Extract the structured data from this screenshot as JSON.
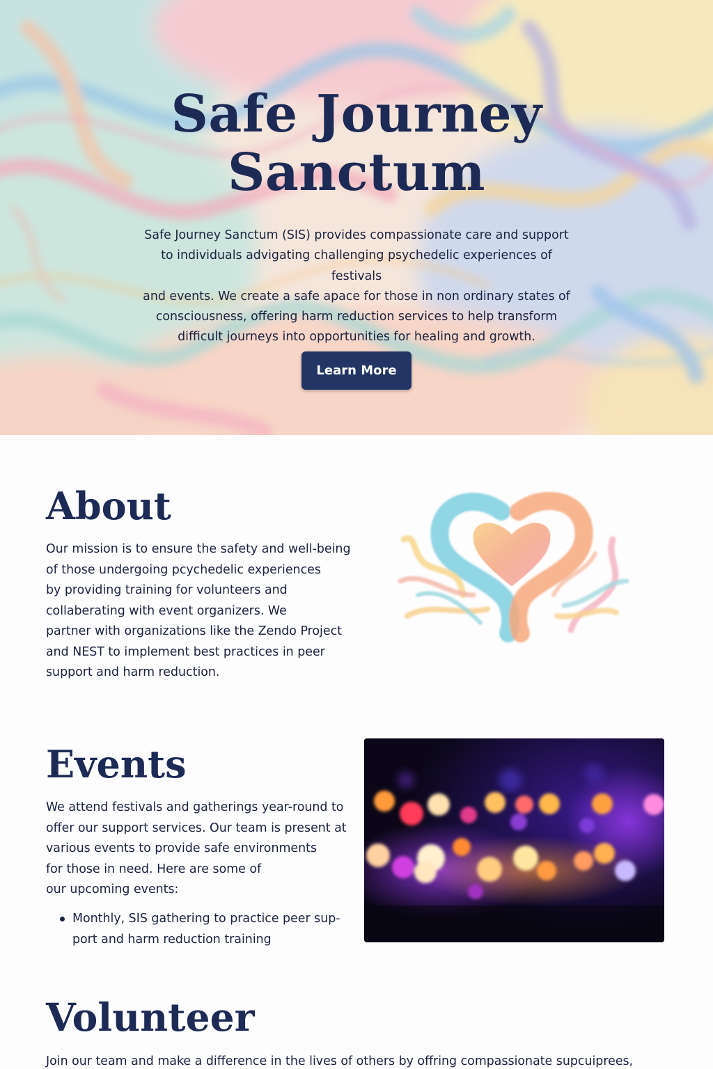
{
  "hero": {
    "title_line1": "Safe Journey",
    "title_line2": "Sanctum",
    "description": [
      "Safe Journey Sanctum (SIS) provides compassionate care and support",
      "to individuals advigating challenging psychedelic experiences of festivals",
      "and events. We create a safe apace for those in non ordinary states of",
      "consciousness, offering harm reduction services to help transform",
      "difficult journeys into opportunities for healing and growth."
    ],
    "button_label": "Learn More"
  },
  "about": {
    "title": "About",
    "text": [
      "Our mission is to ensure the safety and well-being",
      "of those undergoing pcychedelic experiences",
      "by providing training for volunteers and",
      "collaberating with event organizers. We",
      "partner with organizations like the Zendo Project",
      "and NEST to implement best practices in peer",
      "support and harm reduction."
    ],
    "image_icon": "heart-swirl-illustration"
  },
  "events": {
    "title": "Events",
    "text": [
      "We attend festivals and gatherings year-round to",
      "offer our support services. Our team is present at",
      "various events to provide safe environments",
      "for those in need. Here are some of",
      "our upcoming events:"
    ],
    "list": [
      {
        "line1": "Monthly, SIS gathering to practice peer sup-",
        "line2": "port and harm reduction training"
      }
    ],
    "image_icon": "bokeh-lights-photo"
  },
  "volunteer": {
    "title": "Volunteer",
    "text": "Join our team and make a difference in the lives of others by offring compassionate supcuiprees,"
  },
  "colors": {
    "navy": "#1c2a55",
    "button": "#233564",
    "text": "#1a2240"
  }
}
